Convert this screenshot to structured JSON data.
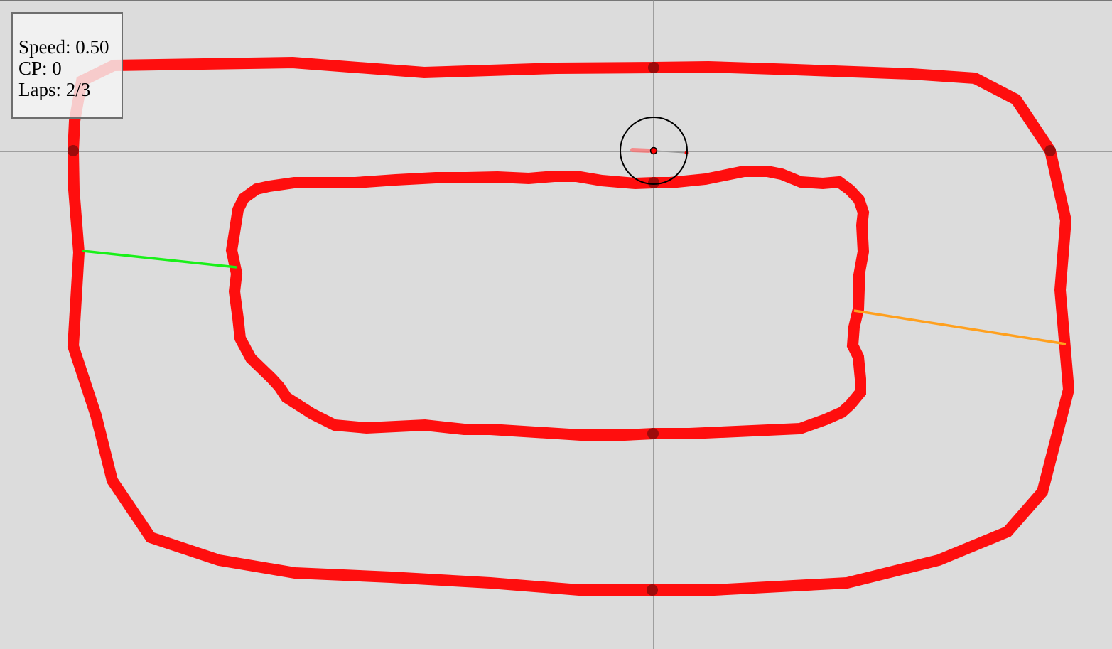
{
  "hud": {
    "speed_label": "Speed:",
    "speed_value": "0.50",
    "checkpoint_label": "CP:",
    "checkpoint_value": "0",
    "laps_label": "Laps:",
    "laps_value": "2/3"
  },
  "colors": {
    "background": "#dcdcdc",
    "track_border": "#ff0e0e",
    "axis_lines": "#8a8a8a",
    "checkpoint_active": "#19f019",
    "checkpoint_next": "#ffa01e",
    "car_body": "#ff0000",
    "sensor_ring": "#000000",
    "node_markers": "#8c0a0a"
  },
  "icons": {
    "car": "car-icon",
    "sensor_ring": "sensor-ring-icon",
    "track_node": "track-node-icon"
  }
}
